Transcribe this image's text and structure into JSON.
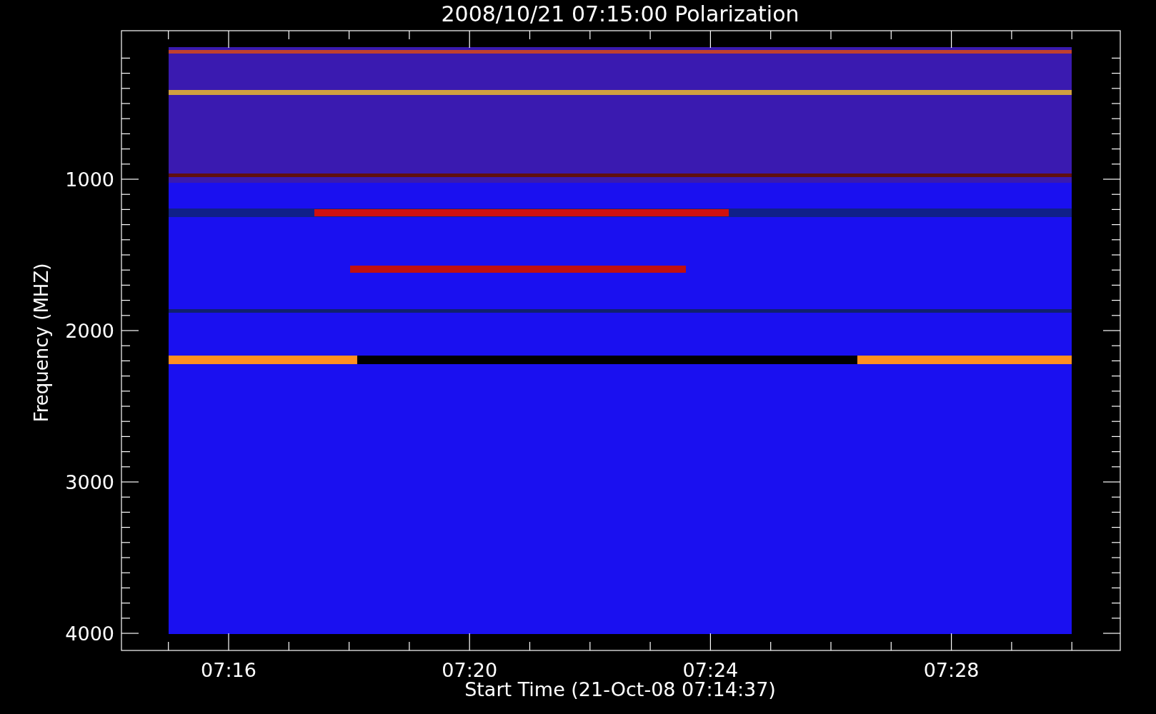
{
  "title": "2008/10/21 07:15:00 Polarization",
  "y_axis": {
    "label": "Frequency (MHZ)",
    "ticks": [
      "1000",
      "2000",
      "3000",
      "4000"
    ]
  },
  "x_axis": {
    "label": "Start Time (21-Oct-08 07:14:37)",
    "ticks": [
      "07:16",
      "07:20",
      "07:24",
      "07:28"
    ]
  }
}
